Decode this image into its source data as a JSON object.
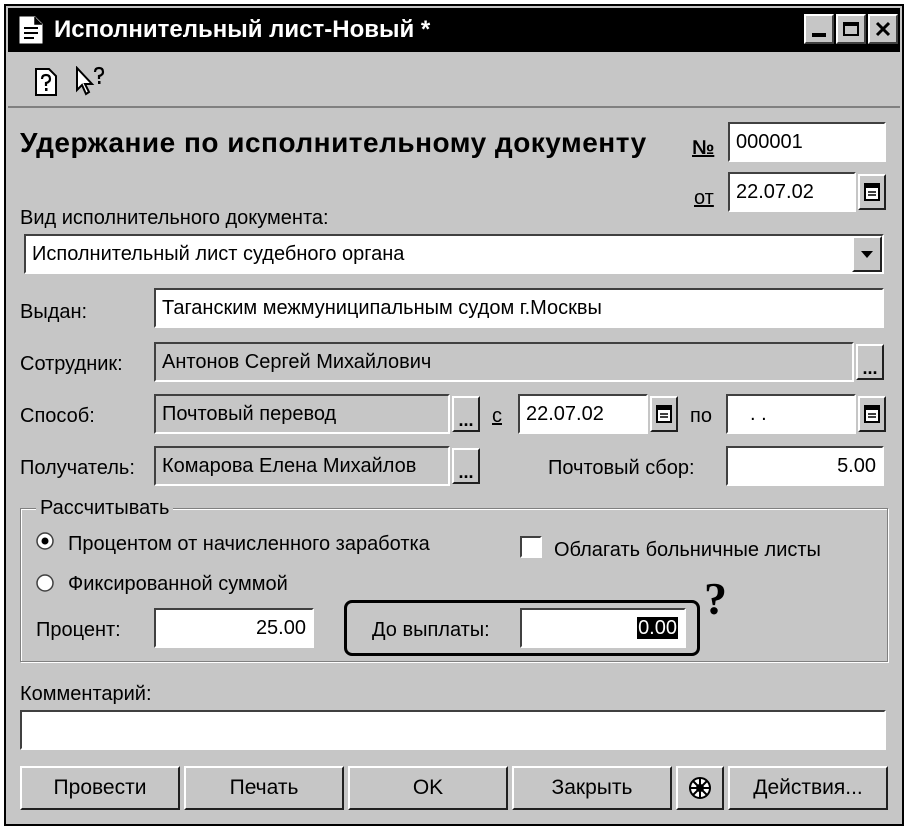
{
  "window": {
    "title": "Исполнительный лист-Новый *",
    "title_icon": "document-icon",
    "controls": [
      "minimize-icon",
      "maximize-icon",
      "close-icon"
    ]
  },
  "toolbar": {
    "icons": [
      "help-icon",
      "context-help-icon"
    ]
  },
  "form": {
    "heading": "Удержание по исполнительному документу",
    "number_label": "№",
    "number_value": "000001",
    "date_label": "от",
    "date_value": "22.07.02",
    "doc_type_label": "Вид исполнительного документа:",
    "doc_type_value": "Исполнительный лист судебного органа",
    "issued_label": "Выдан:",
    "issued_value": "Таганским межмуниципальным судом г.Москвы",
    "employee_label": "Сотрудник:",
    "employee_value": "Антонов Сергей Михайлович",
    "method_label": "Способ:",
    "method_value": "Почтовый перевод",
    "from_label": "с",
    "from_value": "22.07.02",
    "to_label": "по",
    "to_value": ". .",
    "recipient_label": "Получатель:",
    "recipient_value": "Комарова Елена Михайлов",
    "postal_fee_label": "Почтовый сбор:",
    "postal_fee_value": "5.00",
    "ellipsis": "...",
    "calc_group_label": "Рассчитывать",
    "radio_percent_label": "Процентом от начисленного заработка",
    "radio_fixed_label": "Фиксированной суммой",
    "sick_leave_label": "Облагать больничные листы",
    "percent_label": "Процент:",
    "percent_value": "25.00",
    "until_payment_label": "До выплаты:",
    "until_payment_value": "0.00",
    "question_mark": "?",
    "comment_label": "Комментарий:",
    "comment_value": ""
  },
  "buttons": {
    "post": "Провести",
    "print": "Печать",
    "ok": "OK",
    "close": "Закрыть",
    "actions": "Действия..."
  },
  "colors": {
    "window_bg": "#c6c6c6",
    "titlebar_bg": "#000000",
    "field_bg": "#ffffff"
  }
}
